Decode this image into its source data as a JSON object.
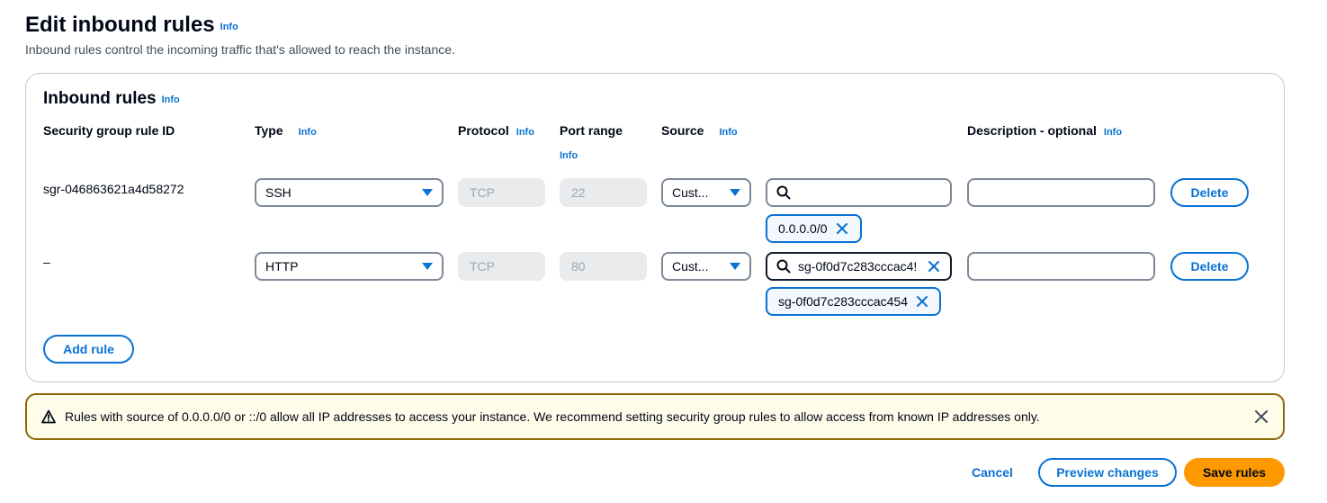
{
  "page": {
    "title": "Edit inbound rules",
    "info": "Info",
    "description": "Inbound rules control the incoming traffic that's allowed to reach the instance."
  },
  "panel": {
    "title": "Inbound rules",
    "info": "Info",
    "columns": {
      "rule_id": "Security group rule ID",
      "type": "Type",
      "protocol": "Protocol",
      "port_range": "Port range",
      "source": "Source",
      "description": "Description - optional"
    }
  },
  "rules": [
    {
      "rule_id": "sgr-046863621a4d58272",
      "type": "SSH",
      "protocol": "TCP",
      "port_range": "22",
      "source_type": "Cust...",
      "source_search": "",
      "source_token": "0.0.0.0/0",
      "description": "",
      "delete_label": "Delete"
    },
    {
      "rule_id": "–",
      "type": "HTTP",
      "protocol": "TCP",
      "port_range": "80",
      "source_type": "Cust...",
      "source_search": "sg-0f0d7c283cccac4!",
      "source_token": "sg-0f0d7c283cccac454",
      "description": "",
      "delete_label": "Delete"
    }
  ],
  "add_rule_label": "Add rule",
  "alert": {
    "text": "Rules with source of 0.0.0.0/0 or ::/0 allow all IP addresses to access your instance. We recommend setting security group rules to allow access from known IP addresses only."
  },
  "footer": {
    "cancel": "Cancel",
    "preview": "Preview changes",
    "save": "Save rules"
  },
  "colors": {
    "link_blue": "#0972d3",
    "primary_orange": "#ff9900",
    "warning_border": "#8d6605",
    "warning_bg": "#fffce9"
  }
}
